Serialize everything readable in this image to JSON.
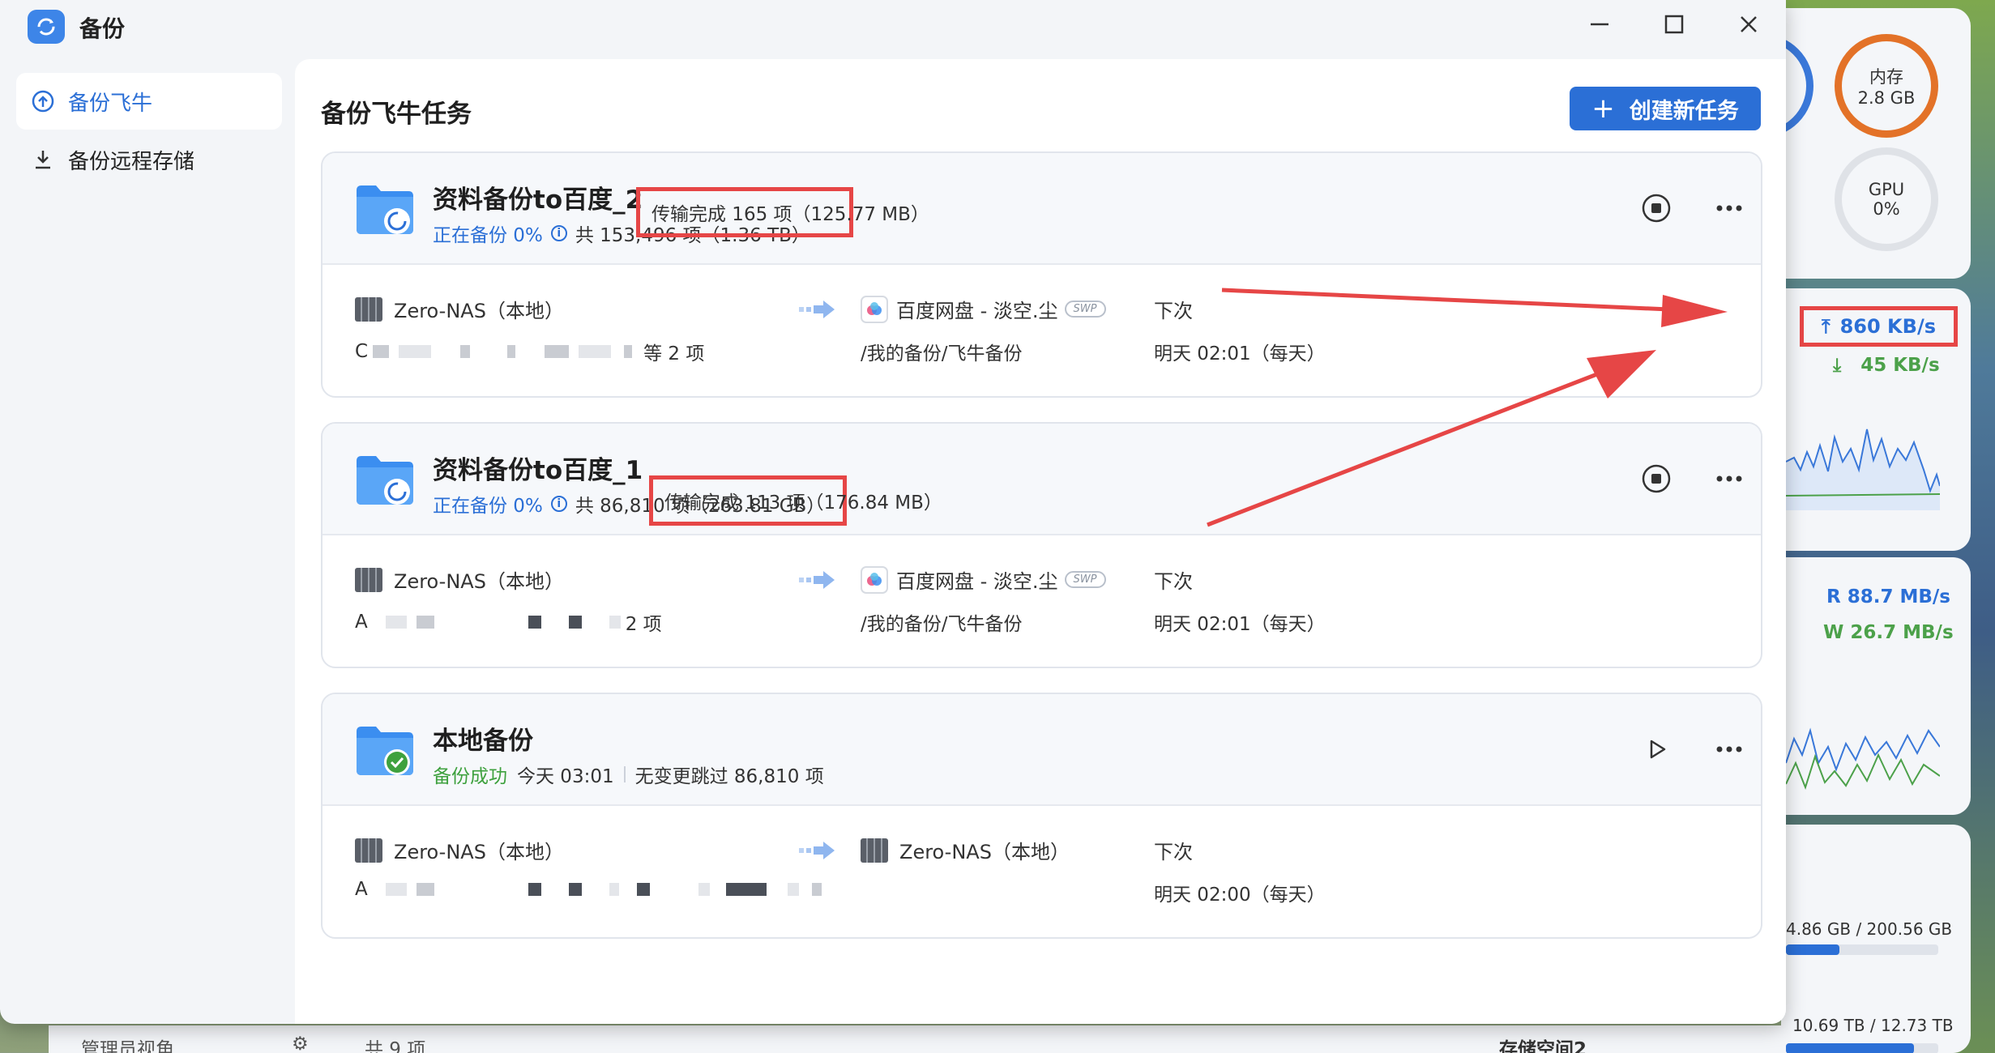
{
  "window": {
    "title": "备份",
    "page_title": "备份飞牛任务",
    "create_button": "创建新任务"
  },
  "sidebar": {
    "items": [
      {
        "label": "备份飞牛"
      },
      {
        "label": "备份远程存储"
      }
    ]
  },
  "tasks": [
    {
      "name": "资料备份to百度_2",
      "status": "正在备份 0%",
      "total": "共 153,496 项（1.36 TB）",
      "transfer": "传输完成 165 项（125.77 MB）",
      "source": "Zero-NAS（本地）",
      "source_path_suffix": "等 2 项",
      "source_path_prefix": "C",
      "dest": "百度网盘 - 淡空.尘",
      "dest_badge": "SWP",
      "dest_path": "/我的备份/飞牛备份",
      "next_label": "下次",
      "next_time": "明天 02:01（每天）"
    },
    {
      "name": "资料备份to百度_1",
      "status": "正在备份 0%",
      "total": "共 86,810 项（263.81 GB）",
      "transfer": "传输完成 113 项（176.84 MB）",
      "source": "Zero-NAS（本地）",
      "source_path_prefix": "A",
      "source_path_suffix": "2 项",
      "dest": "百度网盘 - 淡空.尘",
      "dest_badge": "SWP",
      "dest_path": "/我的备份/飞牛备份",
      "next_label": "下次",
      "next_time": "明天 02:01（每天）"
    },
    {
      "name": "本地备份",
      "status": "备份成功",
      "time": "今天 03:01",
      "skipped": "无变更跳过 86,810 项",
      "source": "Zero-NAS（本地）",
      "source_path_prefix": "A",
      "dest": "Zero-NAS（本地）",
      "next_label": "下次",
      "next_time": "明天 02:00（每天）"
    }
  ],
  "desktop": {
    "memory_label": "内存",
    "memory_value": "2.8 GB",
    "gpu_label": "GPU",
    "gpu_value": "0%",
    "net_up": "860 KB/s",
    "net_down": "45 KB/s",
    "disk_read": "R  88.7 MB/s",
    "disk_write": "W  26.7 MB/s",
    "storage1": "4.86 GB / 200.56 GB",
    "storage1_fill": 0.35,
    "storage2_name": "存储空间2",
    "storage2": "10.69 TB / 12.73 TB",
    "storage2_fill": 0.84
  },
  "under_window": {
    "admin_label": "管理员视角",
    "count": "共 9 项"
  },
  "colors": {
    "accent": "#2b6fd6",
    "success": "#3ea13e",
    "highlight": "#e64646",
    "memory": "#e37228"
  }
}
